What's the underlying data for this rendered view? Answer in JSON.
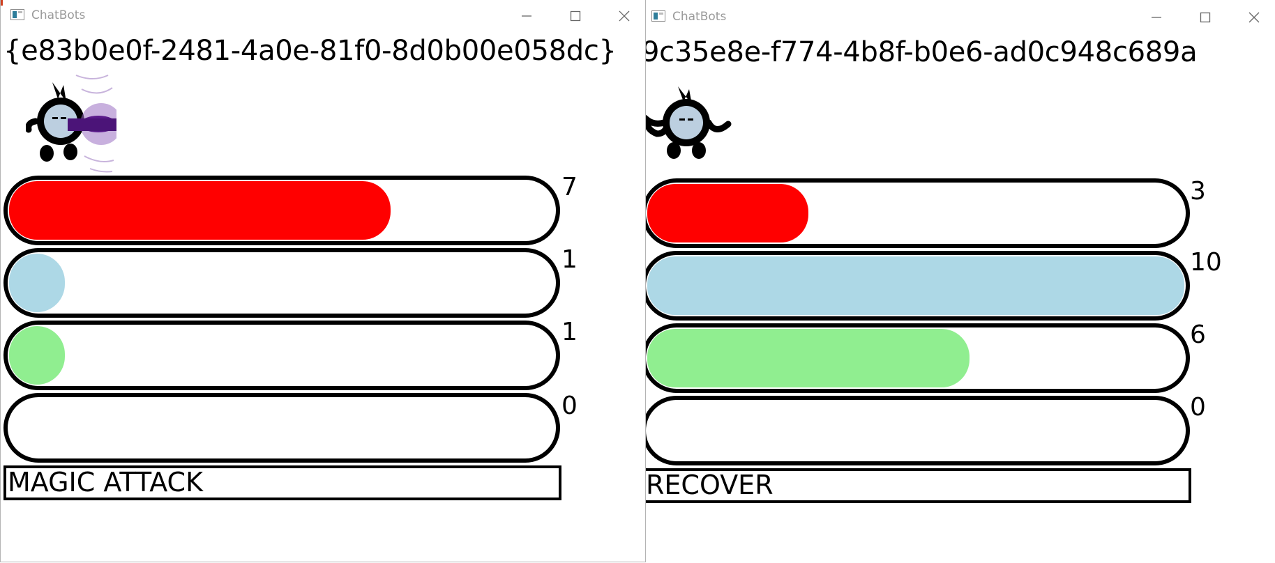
{
  "colors": {
    "health": "#ff0000",
    "mana": "#add8e6",
    "energy": "#90ee90",
    "shield": "#ffffff",
    "magic_effect": "#5a1a8a"
  },
  "windows": [
    {
      "id": "left",
      "title": "ChatBots",
      "guid": "{e83b0e0f-2481-4a0e-81f0-8d0b00e058dc}",
      "avatar": "bot-magic-attack-avatar",
      "stats": [
        {
          "name": "health",
          "value": "7",
          "fill": 0.7
        },
        {
          "name": "mana",
          "value": "1",
          "fill": 0.1
        },
        {
          "name": "energy",
          "value": "1",
          "fill": 0.1
        },
        {
          "name": "shield",
          "value": "0",
          "fill": 0.0
        }
      ],
      "action": "MAGIC ATTACK"
    },
    {
      "id": "right",
      "title": "ChatBots",
      "guid": "9c35e8e-f774-4b8f-b0e6-ad0c948c689a",
      "avatar": "bot-recover-avatar",
      "stats": [
        {
          "name": "health",
          "value": "3",
          "fill": 0.3
        },
        {
          "name": "mana",
          "value": "10",
          "fill": 1.0
        },
        {
          "name": "energy",
          "value": "6",
          "fill": 0.6
        },
        {
          "name": "shield",
          "value": "0",
          "fill": 0.0
        }
      ],
      "action": "RECOVER"
    }
  ],
  "window_controls": [
    "minimize-icon",
    "maximize-icon",
    "close-icon"
  ]
}
